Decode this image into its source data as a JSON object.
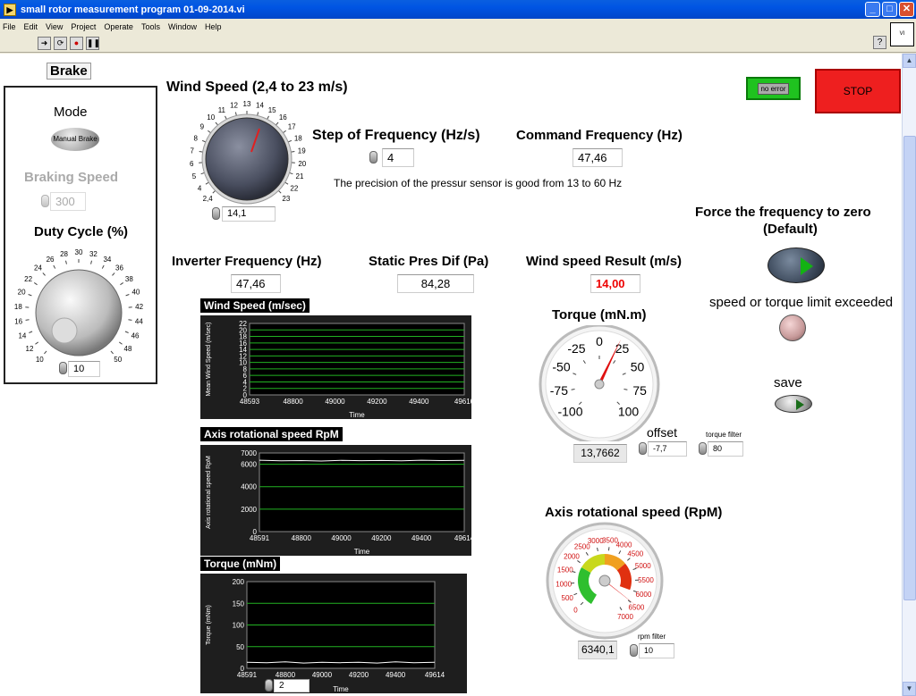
{
  "window": {
    "title": "small rotor measurement program 01-09-2014.vi",
    "min": "_",
    "max": "□",
    "close": "✕"
  },
  "menu": [
    "File",
    "Edit",
    "View",
    "Project",
    "Operate",
    "Tools",
    "Window",
    "Help"
  ],
  "toolbar": {
    "run": "➜",
    "run_cont": "⟳",
    "abort": "●",
    "pause": "❚❚",
    "help": "?"
  },
  "brake": {
    "title": "Brake",
    "mode_label": "Mode",
    "mode_value": "Manual Brake",
    "braking_label": "Braking Speed",
    "braking_value": "300",
    "duty_label": "Duty Cycle (%)",
    "duty_ticks": [
      "10",
      "12",
      "14",
      "16",
      "18",
      "20",
      "22",
      "24",
      "26",
      "28",
      "30",
      "32",
      "34",
      "36",
      "38",
      "40",
      "42",
      "44",
      "46",
      "48",
      "50"
    ],
    "duty_value": "10"
  },
  "wind_speed": {
    "label": "Wind Speed (2,4 to 23 m/s)",
    "ticks": [
      "2,4",
      "4",
      "5",
      "6",
      "7",
      "8",
      "9",
      "10",
      "11",
      "12",
      "13",
      "14",
      "15",
      "16",
      "17",
      "18",
      "19",
      "20",
      "21",
      "22",
      "23"
    ],
    "value": "14,1"
  },
  "step_freq": {
    "label": "Step of Frequency (Hz/s)",
    "value": "4"
  },
  "command_freq": {
    "label": "Command Frequency (Hz)",
    "value": "47,46"
  },
  "precision_note": "The precision of the pressur sensor is good from 13 to 60 Hz",
  "status": {
    "error_label": "no error",
    "stop_label": "STOP"
  },
  "force_zero": {
    "label1": "Force the frequency to zero",
    "label2": "(Default)"
  },
  "inverter": {
    "label": "Inverter Frequency (Hz)",
    "value": "47,46"
  },
  "static_pres": {
    "label": "Static Pres Dif (Pa)",
    "value": "84,28"
  },
  "wind_result": {
    "label": "Wind speed Result (m/s)",
    "value": "14,00"
  },
  "limit": {
    "label": "speed or torque limit exceeded"
  },
  "save": {
    "label": "save"
  },
  "torque_gauge": {
    "label": "Torque (mN.m)",
    "ticks": [
      "-100",
      "-75",
      "-50",
      "-25",
      "0",
      "25",
      "50",
      "75",
      "100"
    ],
    "value": "13,7662"
  },
  "offset": {
    "label": "offset",
    "value": "-7,7"
  },
  "torque_filter": {
    "label": "torque filter",
    "value": "80"
  },
  "rpm_gauge": {
    "label": "Axis rotational speed (RpM)",
    "ticks": [
      "0",
      "500",
      "1000",
      "1500",
      "2000",
      "2500",
      "3000",
      "3500",
      "4000",
      "4500",
      "5000",
      "5500",
      "6000",
      "6500",
      "7000"
    ],
    "value": "6340,1"
  },
  "rpm_filter": {
    "label": "rpm filter",
    "value": "10"
  },
  "chart_data": [
    {
      "type": "line",
      "title": "Wind Speed (m/sec)",
      "xlabel": "Time",
      "ylabel": "Mean Wind Speed (m/sec)",
      "x_ticks": [
        "48593",
        "48800",
        "49000",
        "49200",
        "49400",
        "49616"
      ],
      "y_ticks": [
        "0",
        "2",
        "4",
        "6",
        "8",
        "10",
        "12",
        "14",
        "16",
        "18",
        "20",
        "22"
      ],
      "ylim": [
        0,
        22
      ],
      "xlim": [
        48593,
        49616
      ],
      "grid": "green horizontal lines",
      "series": [
        {
          "values": []
        }
      ]
    },
    {
      "type": "line",
      "title": "Axis rotational speed RpM",
      "xlabel": "Time",
      "ylabel": "Axis rotational speed RpM",
      "x_ticks": [
        "48591",
        "48800",
        "49000",
        "49200",
        "49400",
        "49614"
      ],
      "y_ticks": [
        "0",
        "2000",
        "4000",
        "6000",
        "7000"
      ],
      "ylim": [
        0,
        7000
      ],
      "xlim": [
        48591,
        49614
      ],
      "series": [
        {
          "x": [
            48591,
            48700,
            48800,
            48900,
            49000,
            49100,
            49200,
            49300,
            49400,
            49500,
            49614
          ],
          "values": [
            6350,
            6300,
            6320,
            6280,
            6340,
            6310,
            6330,
            6300,
            6350,
            6320,
            6340
          ]
        }
      ]
    },
    {
      "type": "line",
      "title": "Torque (mNm)",
      "xlabel": "Time",
      "ylabel": "Torque (mNm)",
      "x_ticks": [
        "48591",
        "48800",
        "49000",
        "49200",
        "49400",
        "49614"
      ],
      "y_ticks": [
        "0",
        "50",
        "100",
        "150",
        "200"
      ],
      "ylim": [
        0,
        200
      ],
      "xlim": [
        48591,
        49614
      ],
      "series": [
        {
          "x": [
            48591,
            48700,
            48800,
            48900,
            49000,
            49100,
            49200,
            49300,
            49400,
            49500,
            49614
          ],
          "values": [
            14,
            13,
            15,
            12,
            14,
            13,
            14,
            12,
            15,
            13,
            14
          ]
        }
      ],
      "history_value": "2"
    }
  ]
}
